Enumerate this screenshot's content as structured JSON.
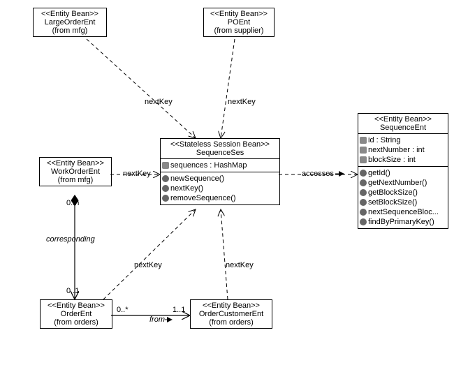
{
  "boxes": {
    "largeOrder": {
      "stereo": "<<Entity Bean>>",
      "name": "LargeOrderEnt",
      "from": "(from mfg)"
    },
    "poEnt": {
      "stereo": "<<Entity Bean>>",
      "name": "POEnt",
      "from": "(from supplier)"
    },
    "workOrder": {
      "stereo": "<<Entity Bean>>",
      "name": "WorkOrderEnt",
      "from": "(from mfg)"
    },
    "orderEnt": {
      "stereo": "<<Entity Bean>>",
      "name": "OrderEnt",
      "from": "(from orders)"
    },
    "orderCustomer": {
      "stereo": "<<Entity Bean>>",
      "name": "OrderCustomerEnt",
      "from": "(from orders)"
    },
    "sequenceSes": {
      "stereo": "<<Stateless Session Bean>>",
      "name": "SequenceSes",
      "attrs": [
        "sequences : HashMap"
      ],
      "ops": [
        "newSequence()",
        "nextKey()",
        "removeSequence()"
      ]
    },
    "sequenceEnt": {
      "stereo": "<<Entity Bean>>",
      "name": "SequenceEnt",
      "attrs": [
        "id : String",
        "nextNumber : int",
        "blockSize : int"
      ],
      "ops": [
        "getId()",
        "getNextNumber()",
        "getBlockSize()",
        "setBlockSize()",
        "nextSequenceBloc...",
        "findByPrimaryKey()"
      ]
    }
  },
  "labels": {
    "nextKey1": "nextKey",
    "nextKey2": "nextKey",
    "nextKey3": "nextKey",
    "nextKey4": "nextKey",
    "nextKey5": "nextKey",
    "accesses": "accesses",
    "corresponding": "corresponding",
    "from": "from",
    "mult0n": "0..n",
    "mult01": "0..1",
    "mult0s": "0..*",
    "mult11": "1..1"
  }
}
